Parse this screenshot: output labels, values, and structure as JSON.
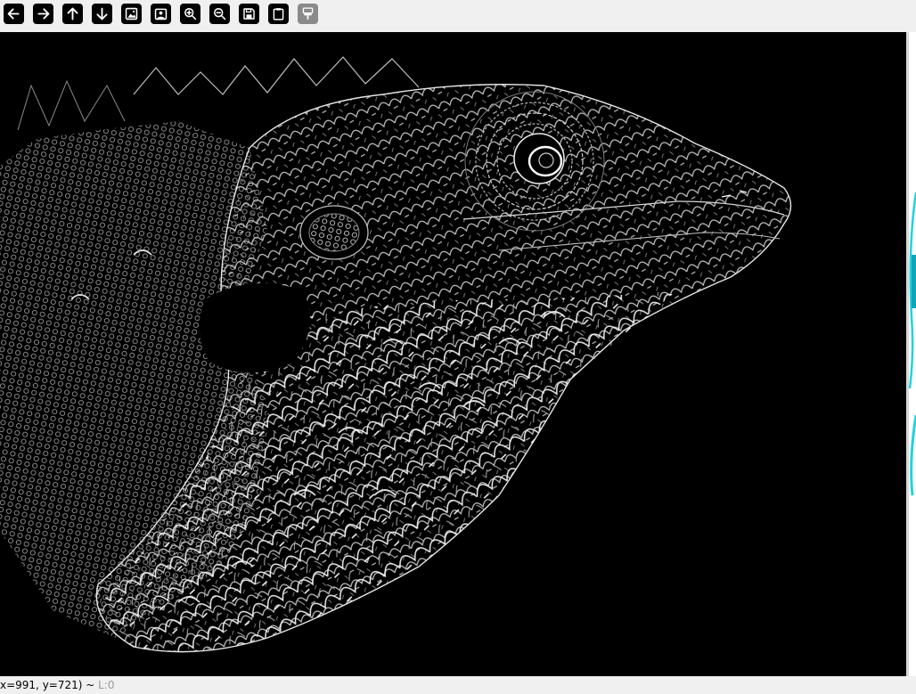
{
  "toolbar": {
    "buttons": [
      {
        "name": "back-button",
        "icon": "arrow-left-icon"
      },
      {
        "name": "forward-button",
        "icon": "arrow-right-icon"
      },
      {
        "name": "up-button",
        "icon": "arrow-up-icon"
      },
      {
        "name": "down-button",
        "icon": "arrow-down-icon"
      },
      {
        "name": "image-button",
        "icon": "image-icon"
      },
      {
        "name": "image-settings-button",
        "icon": "image-settings-icon"
      },
      {
        "name": "zoom-in-button",
        "icon": "zoom-in-icon"
      },
      {
        "name": "zoom-out-button",
        "icon": "zoom-out-icon"
      },
      {
        "name": "save-button",
        "icon": "floppy-disk-icon"
      },
      {
        "name": "clipboard-button",
        "icon": "clipboard-icon"
      },
      {
        "name": "brush-button",
        "icon": "paint-brush-icon",
        "disabled": true
      }
    ]
  },
  "image": {
    "description_icon": "lizard-edge-filter-image",
    "background": "#000000"
  },
  "status": {
    "coords": "x=991, y=721) ~ ",
    "layer": "L:0"
  },
  "colors": {
    "accent_right_edge": "#1fd3e0"
  }
}
